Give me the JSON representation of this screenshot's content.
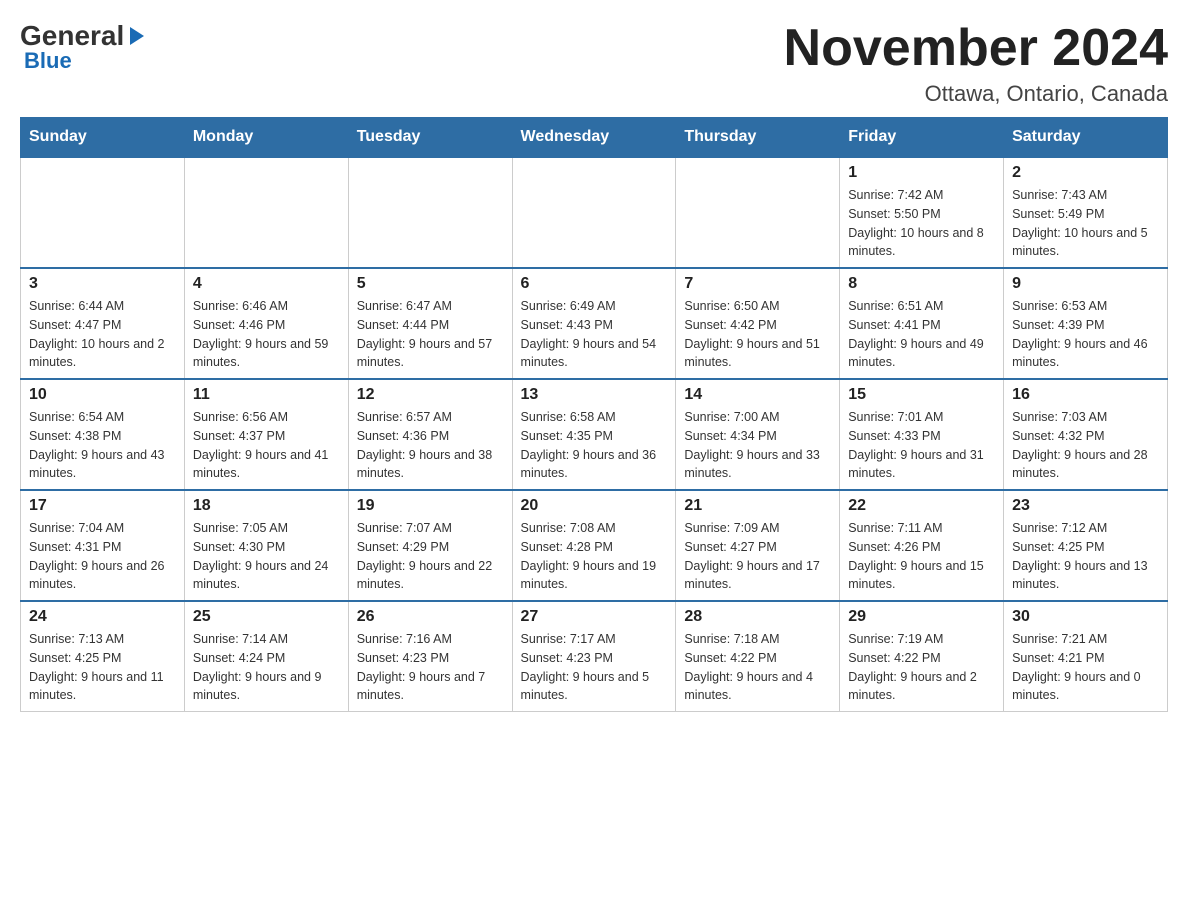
{
  "header": {
    "logo_general": "General",
    "logo_blue": "Blue",
    "month_title": "November 2024",
    "location": "Ottawa, Ontario, Canada"
  },
  "days_of_week": [
    "Sunday",
    "Monday",
    "Tuesday",
    "Wednesday",
    "Thursday",
    "Friday",
    "Saturday"
  ],
  "weeks": [
    [
      {
        "day": "",
        "sunrise": "",
        "sunset": "",
        "daylight": ""
      },
      {
        "day": "",
        "sunrise": "",
        "sunset": "",
        "daylight": ""
      },
      {
        "day": "",
        "sunrise": "",
        "sunset": "",
        "daylight": ""
      },
      {
        "day": "",
        "sunrise": "",
        "sunset": "",
        "daylight": ""
      },
      {
        "day": "",
        "sunrise": "",
        "sunset": "",
        "daylight": ""
      },
      {
        "day": "1",
        "sunrise": "Sunrise: 7:42 AM",
        "sunset": "Sunset: 5:50 PM",
        "daylight": "Daylight: 10 hours and 8 minutes."
      },
      {
        "day": "2",
        "sunrise": "Sunrise: 7:43 AM",
        "sunset": "Sunset: 5:49 PM",
        "daylight": "Daylight: 10 hours and 5 minutes."
      }
    ],
    [
      {
        "day": "3",
        "sunrise": "Sunrise: 6:44 AM",
        "sunset": "Sunset: 4:47 PM",
        "daylight": "Daylight: 10 hours and 2 minutes."
      },
      {
        "day": "4",
        "sunrise": "Sunrise: 6:46 AM",
        "sunset": "Sunset: 4:46 PM",
        "daylight": "Daylight: 9 hours and 59 minutes."
      },
      {
        "day": "5",
        "sunrise": "Sunrise: 6:47 AM",
        "sunset": "Sunset: 4:44 PM",
        "daylight": "Daylight: 9 hours and 57 minutes."
      },
      {
        "day": "6",
        "sunrise": "Sunrise: 6:49 AM",
        "sunset": "Sunset: 4:43 PM",
        "daylight": "Daylight: 9 hours and 54 minutes."
      },
      {
        "day": "7",
        "sunrise": "Sunrise: 6:50 AM",
        "sunset": "Sunset: 4:42 PM",
        "daylight": "Daylight: 9 hours and 51 minutes."
      },
      {
        "day": "8",
        "sunrise": "Sunrise: 6:51 AM",
        "sunset": "Sunset: 4:41 PM",
        "daylight": "Daylight: 9 hours and 49 minutes."
      },
      {
        "day": "9",
        "sunrise": "Sunrise: 6:53 AM",
        "sunset": "Sunset: 4:39 PM",
        "daylight": "Daylight: 9 hours and 46 minutes."
      }
    ],
    [
      {
        "day": "10",
        "sunrise": "Sunrise: 6:54 AM",
        "sunset": "Sunset: 4:38 PM",
        "daylight": "Daylight: 9 hours and 43 minutes."
      },
      {
        "day": "11",
        "sunrise": "Sunrise: 6:56 AM",
        "sunset": "Sunset: 4:37 PM",
        "daylight": "Daylight: 9 hours and 41 minutes."
      },
      {
        "day": "12",
        "sunrise": "Sunrise: 6:57 AM",
        "sunset": "Sunset: 4:36 PM",
        "daylight": "Daylight: 9 hours and 38 minutes."
      },
      {
        "day": "13",
        "sunrise": "Sunrise: 6:58 AM",
        "sunset": "Sunset: 4:35 PM",
        "daylight": "Daylight: 9 hours and 36 minutes."
      },
      {
        "day": "14",
        "sunrise": "Sunrise: 7:00 AM",
        "sunset": "Sunset: 4:34 PM",
        "daylight": "Daylight: 9 hours and 33 minutes."
      },
      {
        "day": "15",
        "sunrise": "Sunrise: 7:01 AM",
        "sunset": "Sunset: 4:33 PM",
        "daylight": "Daylight: 9 hours and 31 minutes."
      },
      {
        "day": "16",
        "sunrise": "Sunrise: 7:03 AM",
        "sunset": "Sunset: 4:32 PM",
        "daylight": "Daylight: 9 hours and 28 minutes."
      }
    ],
    [
      {
        "day": "17",
        "sunrise": "Sunrise: 7:04 AM",
        "sunset": "Sunset: 4:31 PM",
        "daylight": "Daylight: 9 hours and 26 minutes."
      },
      {
        "day": "18",
        "sunrise": "Sunrise: 7:05 AM",
        "sunset": "Sunset: 4:30 PM",
        "daylight": "Daylight: 9 hours and 24 minutes."
      },
      {
        "day": "19",
        "sunrise": "Sunrise: 7:07 AM",
        "sunset": "Sunset: 4:29 PM",
        "daylight": "Daylight: 9 hours and 22 minutes."
      },
      {
        "day": "20",
        "sunrise": "Sunrise: 7:08 AM",
        "sunset": "Sunset: 4:28 PM",
        "daylight": "Daylight: 9 hours and 19 minutes."
      },
      {
        "day": "21",
        "sunrise": "Sunrise: 7:09 AM",
        "sunset": "Sunset: 4:27 PM",
        "daylight": "Daylight: 9 hours and 17 minutes."
      },
      {
        "day": "22",
        "sunrise": "Sunrise: 7:11 AM",
        "sunset": "Sunset: 4:26 PM",
        "daylight": "Daylight: 9 hours and 15 minutes."
      },
      {
        "day": "23",
        "sunrise": "Sunrise: 7:12 AM",
        "sunset": "Sunset: 4:25 PM",
        "daylight": "Daylight: 9 hours and 13 minutes."
      }
    ],
    [
      {
        "day": "24",
        "sunrise": "Sunrise: 7:13 AM",
        "sunset": "Sunset: 4:25 PM",
        "daylight": "Daylight: 9 hours and 11 minutes."
      },
      {
        "day": "25",
        "sunrise": "Sunrise: 7:14 AM",
        "sunset": "Sunset: 4:24 PM",
        "daylight": "Daylight: 9 hours and 9 minutes."
      },
      {
        "day": "26",
        "sunrise": "Sunrise: 7:16 AM",
        "sunset": "Sunset: 4:23 PM",
        "daylight": "Daylight: 9 hours and 7 minutes."
      },
      {
        "day": "27",
        "sunrise": "Sunrise: 7:17 AM",
        "sunset": "Sunset: 4:23 PM",
        "daylight": "Daylight: 9 hours and 5 minutes."
      },
      {
        "day": "28",
        "sunrise": "Sunrise: 7:18 AM",
        "sunset": "Sunset: 4:22 PM",
        "daylight": "Daylight: 9 hours and 4 minutes."
      },
      {
        "day": "29",
        "sunrise": "Sunrise: 7:19 AM",
        "sunset": "Sunset: 4:22 PM",
        "daylight": "Daylight: 9 hours and 2 minutes."
      },
      {
        "day": "30",
        "sunrise": "Sunrise: 7:21 AM",
        "sunset": "Sunset: 4:21 PM",
        "daylight": "Daylight: 9 hours and 0 minutes."
      }
    ]
  ]
}
